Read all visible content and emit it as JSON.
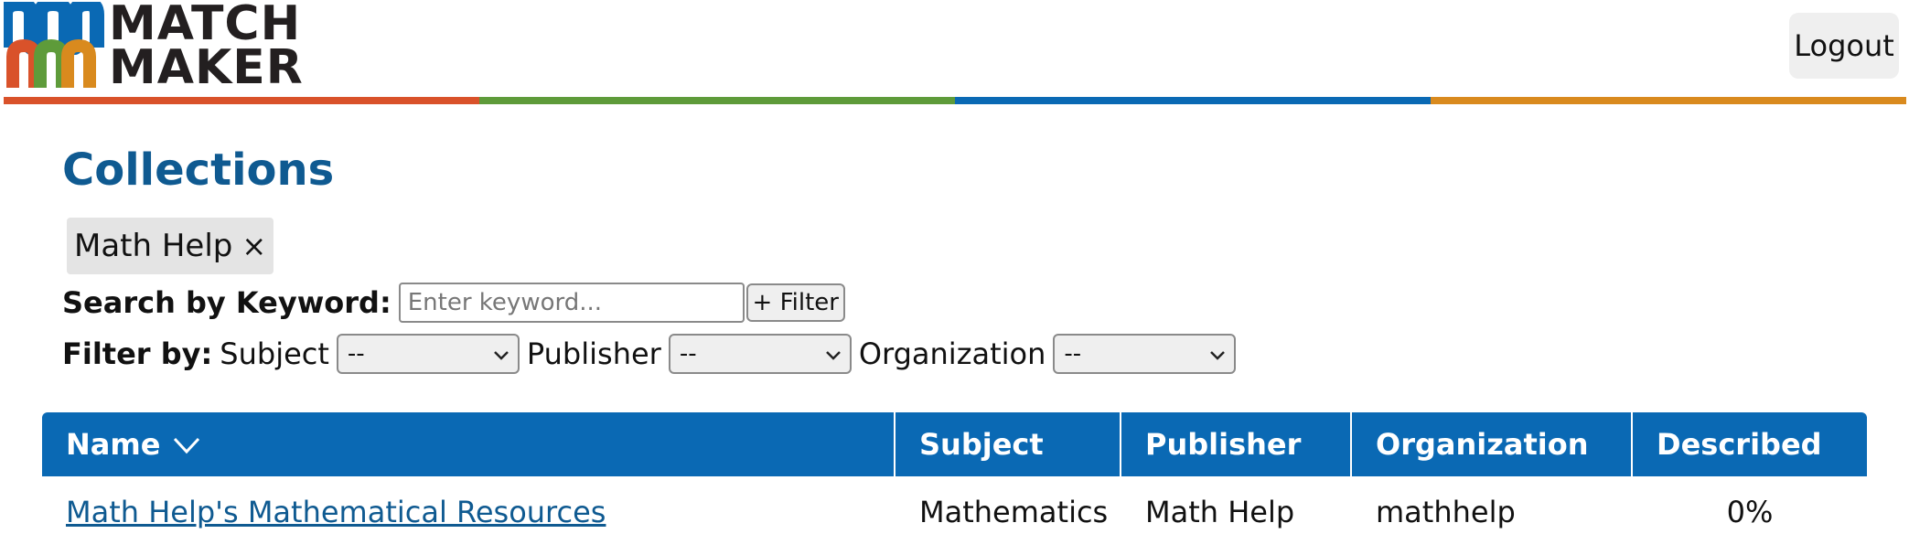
{
  "brand": {
    "logo_line1": "MATCH",
    "logo_line2": "MAKER",
    "colors": [
      "#d9522a",
      "#5e9b3a",
      "#0a69b4",
      "#d98a1e"
    ]
  },
  "header": {
    "logout_label": "Logout"
  },
  "page": {
    "title": "Collections"
  },
  "active_filter": {
    "label": "Math Help",
    "remove_symbol": "×"
  },
  "search": {
    "label": "Search by Keyword:",
    "placeholder": "Enter keyword...",
    "value": "",
    "filter_button": "+ Filter"
  },
  "filters": {
    "label": "Filter by:",
    "subject_label": "Subject",
    "subject_value": "--",
    "publisher_label": "Publisher",
    "publisher_value": "--",
    "organization_label": "Organization",
    "organization_value": "--"
  },
  "table": {
    "header_color": "#0a69b4",
    "columns": [
      "Name",
      "Subject",
      "Publisher",
      "Organization",
      "Described"
    ],
    "sorted_column": "Name",
    "rows": [
      {
        "name": "Math Help's Mathematical Resources",
        "subject": "Mathematics",
        "publisher": "Math Help",
        "organization": "mathhelp",
        "described": "0%"
      }
    ]
  }
}
